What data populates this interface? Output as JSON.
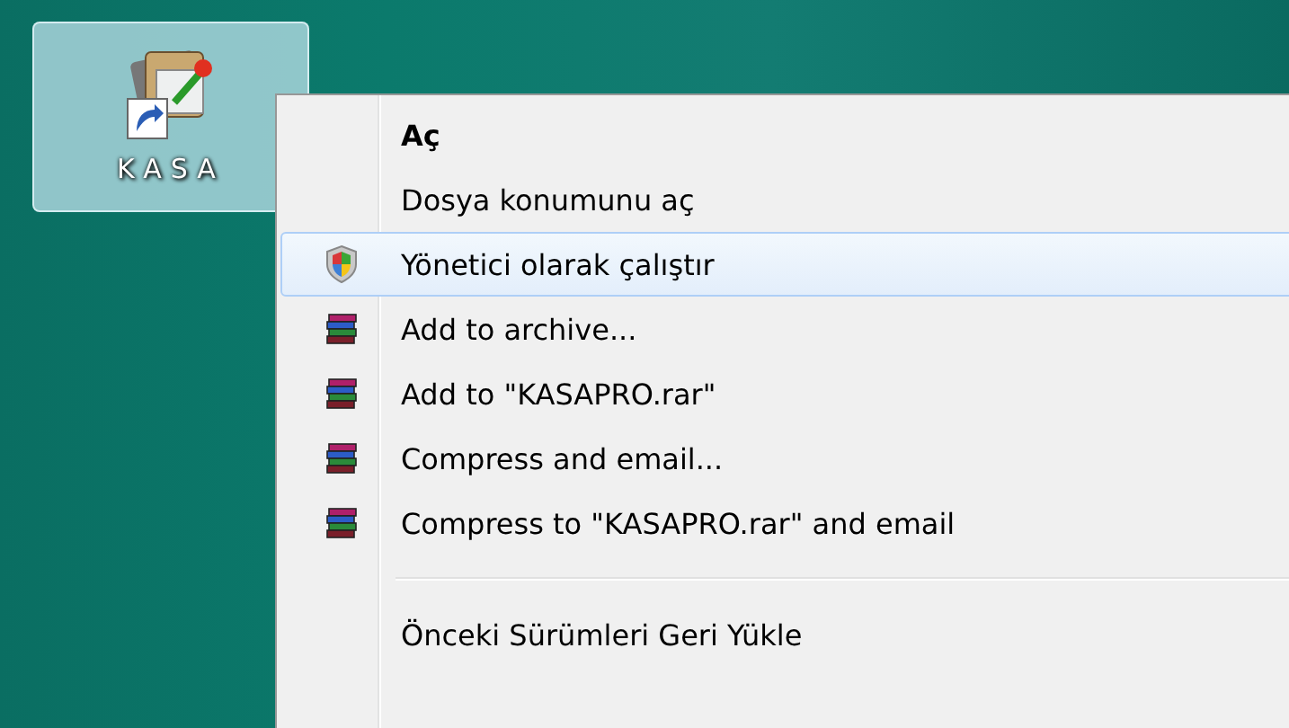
{
  "desktop_icon": {
    "label": "KASA",
    "selected": true
  },
  "context_menu": {
    "items": [
      {
        "kind": "plain",
        "label": "Aç",
        "default": true,
        "selected": false
      },
      {
        "kind": "plain",
        "label": "Dosya konumunu aç",
        "default": false,
        "selected": false
      },
      {
        "kind": "admin",
        "label": "Yönetici olarak çalıştır",
        "default": false,
        "selected": true
      },
      {
        "kind": "archive",
        "label": "Add to archive...",
        "default": false,
        "selected": false
      },
      {
        "kind": "archive",
        "label": "Add to \"KASAPRO.rar\"",
        "default": false,
        "selected": false
      },
      {
        "kind": "archive",
        "label": "Compress and email...",
        "default": false,
        "selected": false
      },
      {
        "kind": "archive",
        "label": "Compress to \"KASAPRO.rar\" and email",
        "default": false,
        "selected": false
      },
      {
        "kind": "separator"
      },
      {
        "kind": "plain",
        "label": "Önceki Sürümleri Geri Yükle",
        "default": false,
        "selected": false
      }
    ]
  }
}
